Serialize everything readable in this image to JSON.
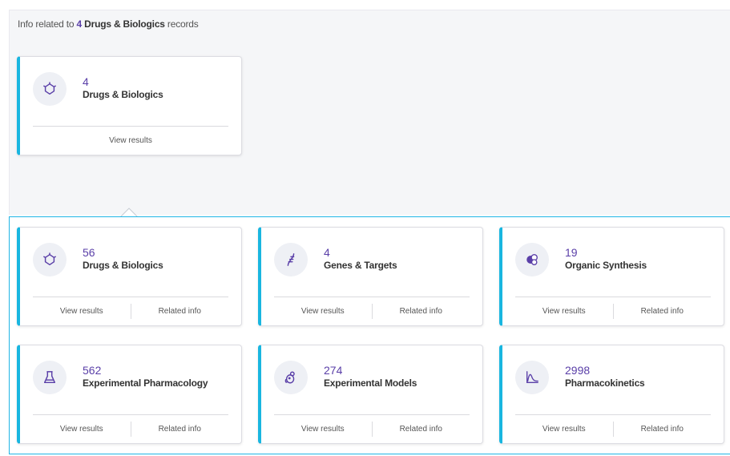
{
  "header": {
    "prefix": "Info related to",
    "count": "4",
    "content_type": "Drugs & Biologics",
    "suffix": "records"
  },
  "source_card": {
    "count": "4",
    "label": "Drugs & Biologics",
    "view_results": "View results",
    "icon": "drug-molecule-icon"
  },
  "related_cards": [
    {
      "count": "56",
      "label": "Drugs & Biologics",
      "icon": "drug-molecule-icon",
      "view_results": "View results",
      "related_info": "Related info"
    },
    {
      "count": "4",
      "label": "Genes & Targets",
      "icon": "dna-icon",
      "view_results": "View results",
      "related_info": "Related info"
    },
    {
      "count": "19",
      "label": "Organic Synthesis",
      "icon": "synthesis-icon",
      "view_results": "View results",
      "related_info": "Related info"
    },
    {
      "count": "562",
      "label": "Experimental Pharmacology",
      "icon": "flask-icon",
      "view_results": "View results",
      "related_info": "Related info"
    },
    {
      "count": "274",
      "label": "Experimental Models",
      "icon": "mouse-icon",
      "view_results": "View results",
      "related_info": "Related info"
    },
    {
      "count": "2998",
      "label": "Pharmacokinetics",
      "icon": "pk-curve-icon",
      "view_results": "View results",
      "related_info": "Related info"
    }
  ],
  "colors": {
    "accent": "#19b6e0",
    "number": "#5a3fa8",
    "icon": "#5a3fa8"
  }
}
